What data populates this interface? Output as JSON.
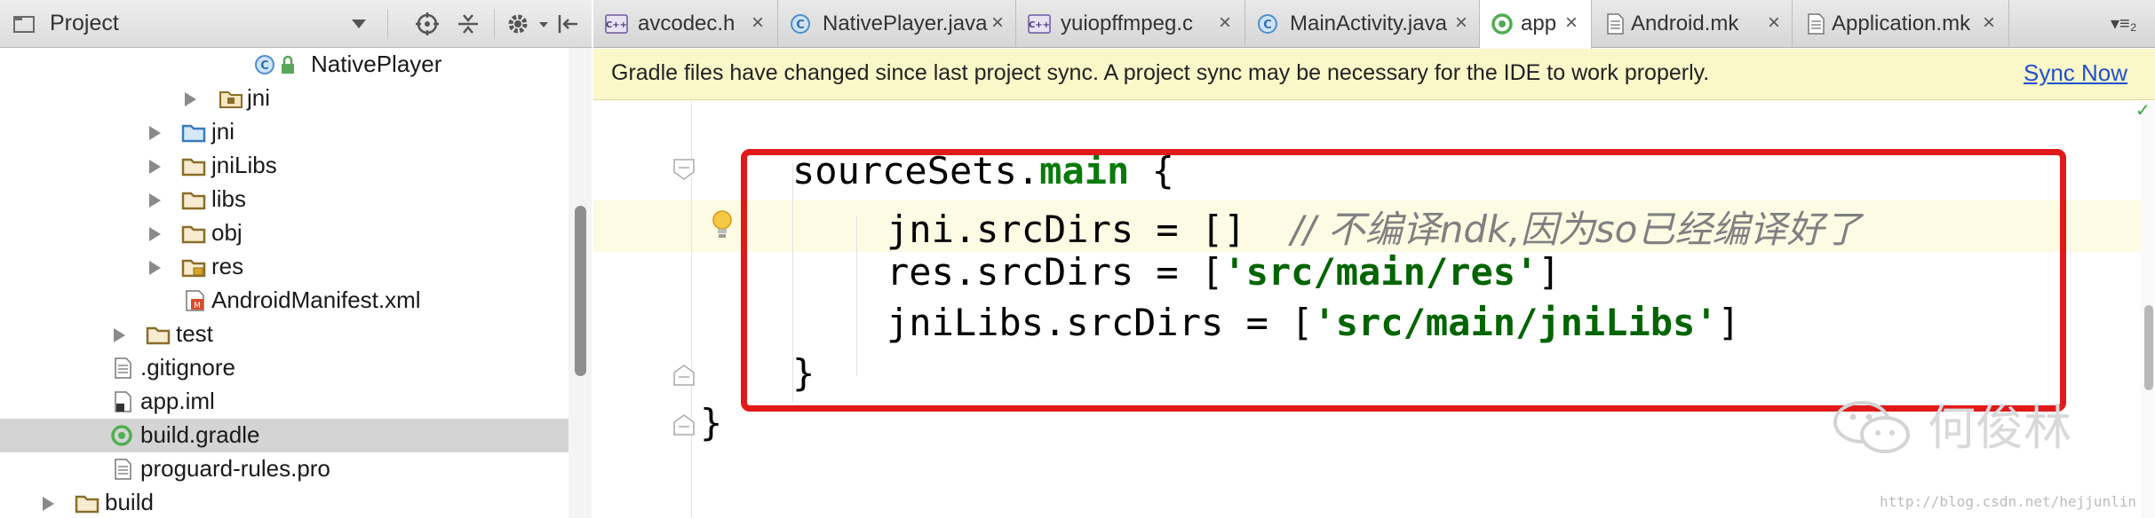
{
  "project_panel": {
    "title": "Project",
    "tree": [
      {
        "label": "NativePlayer",
        "icon": "class-c-icon",
        "arrow": false
      },
      {
        "label": "jni",
        "icon": "package-folder-icon",
        "arrow": true
      },
      {
        "label": "jni",
        "icon": "source-folder-icon",
        "arrow": true
      },
      {
        "label": "jniLibs",
        "icon": "folder-icon",
        "arrow": true
      },
      {
        "label": "libs",
        "icon": "folder-icon",
        "arrow": true
      },
      {
        "label": "obj",
        "icon": "folder-icon",
        "arrow": true
      },
      {
        "label": "res",
        "icon": "resource-folder-icon",
        "arrow": true
      },
      {
        "label": "AndroidManifest.xml",
        "icon": "manifest-icon",
        "arrow": false
      },
      {
        "label": "test",
        "icon": "folder-icon",
        "arrow": true
      },
      {
        "label": ".gitignore",
        "icon": "text-file-icon",
        "arrow": false
      },
      {
        "label": "app.iml",
        "icon": "iml-file-icon",
        "arrow": false
      },
      {
        "label": "build.gradle",
        "icon": "gradle-icon",
        "arrow": false,
        "selected": true
      },
      {
        "label": "proguard-rules.pro",
        "icon": "text-file-icon",
        "arrow": false
      },
      {
        "label": "build",
        "icon": "folder-icon",
        "arrow": true
      }
    ]
  },
  "tabs": [
    {
      "label": "avcodec.h",
      "icon": "cpp-header-icon",
      "close": "×"
    },
    {
      "label": "NativePlayer.java",
      "icon": "class-c-icon",
      "close": "×"
    },
    {
      "label": "yuiopffmpeg.c",
      "icon": "c-source-icon",
      "close": "×"
    },
    {
      "label": "MainActivity.java",
      "icon": "class-c-icon",
      "close": "×"
    },
    {
      "label": "app",
      "icon": "gradle-icon",
      "close": "×",
      "active": true
    },
    {
      "label": "Android.mk",
      "icon": "text-file-icon",
      "close": "×"
    },
    {
      "label": "Application.mk",
      "icon": "text-file-icon",
      "close": "×"
    }
  ],
  "tab_overflow": "▾≡₂",
  "sync_banner": {
    "message": "Gradle files have changed since last project sync. A project sync may be necessary for the IDE to work properly.",
    "link": "Sync Now"
  },
  "code": {
    "line1": {
      "ident": "sourceSets.",
      "prop": "main",
      "rest": " {"
    },
    "line2": {
      "text": "jni.srcDirs = []  ",
      "comment": "// 不编译ndk,因为so已经编译好了"
    },
    "line3": {
      "pre": "res.srcDirs = [",
      "str": "'src/main/res'",
      "post": "]"
    },
    "line4": {
      "pre": "jniLibs.srcDirs = [",
      "str": "'src/main/jniLibs'",
      "post": "]"
    },
    "line5": "}",
    "line6": "}"
  },
  "watermark": {
    "text": "何俊林",
    "url": "http://blog.csdn.net/hejjunlin"
  },
  "colors": {
    "highlight_box": "#e01919",
    "banner_bg": "#faf7c8",
    "link": "#2050d0"
  }
}
